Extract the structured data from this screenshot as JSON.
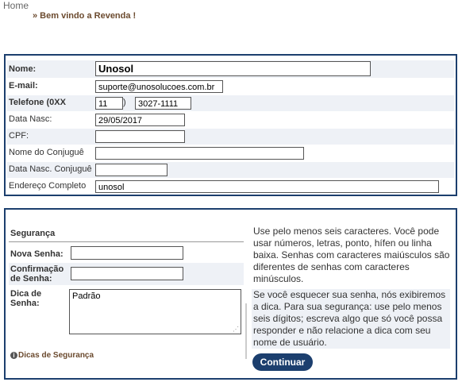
{
  "breadcrumb": {
    "home": "Home",
    "welcome": "» Bem vindo a Revenda !"
  },
  "profile": {
    "nome_label": "Nome:",
    "nome_value": "Unosol",
    "email_label": "E-mail:",
    "email_value": "suporte@unosolucoes.com.br",
    "telefone_label": "Telefone (0XX",
    "telefone_ddd": "11",
    "telefone_paren": ")",
    "telefone_number": "3027-1111",
    "data_nasc_label": "Data Nasc:",
    "data_nasc_value": "29/05/2017",
    "cpf_label": "CPF:",
    "cpf_value": "",
    "conjuge_label": "Nome do Conjuguê",
    "conjuge_value": "",
    "conjuge_nasc_label": "Data Nasc. Conjuguê",
    "conjuge_nasc_value": "",
    "endereco_label": "Endereço Completo",
    "endereco_value": "unosol"
  },
  "security": {
    "title": "Segurança",
    "nova_senha_label": "Nova Senha:",
    "nova_senha_value": "",
    "confirmacao_label_1": "Confirmação",
    "confirmacao_label_2": "de Senha:",
    "confirmacao_value": "",
    "dica_label_1": "Dica de",
    "dica_label_2": "Senha:",
    "dica_value": "Padrão",
    "tips_link": "Dicas de Segurança",
    "help_password": "Use pelo menos seis caracteres. Você pode usar números, letras, ponto, hífen ou linha baixa. Senhas com caracteres maiúsculos são diferentes de senhas com caracteres minúsculos.",
    "help_hint": "Se você esquecer sua senha, nós exibiremos a dica. Para sua segurança: use pelo menos seis dígitos; escreva algo que só você possa responder e não relacione a dica com seu nome de usuário.",
    "continue_label": "Continuar"
  },
  "colors": {
    "border": "#1c3f6e",
    "row_alt": "#eef1f6",
    "link_brown": "#6b4a2e"
  }
}
